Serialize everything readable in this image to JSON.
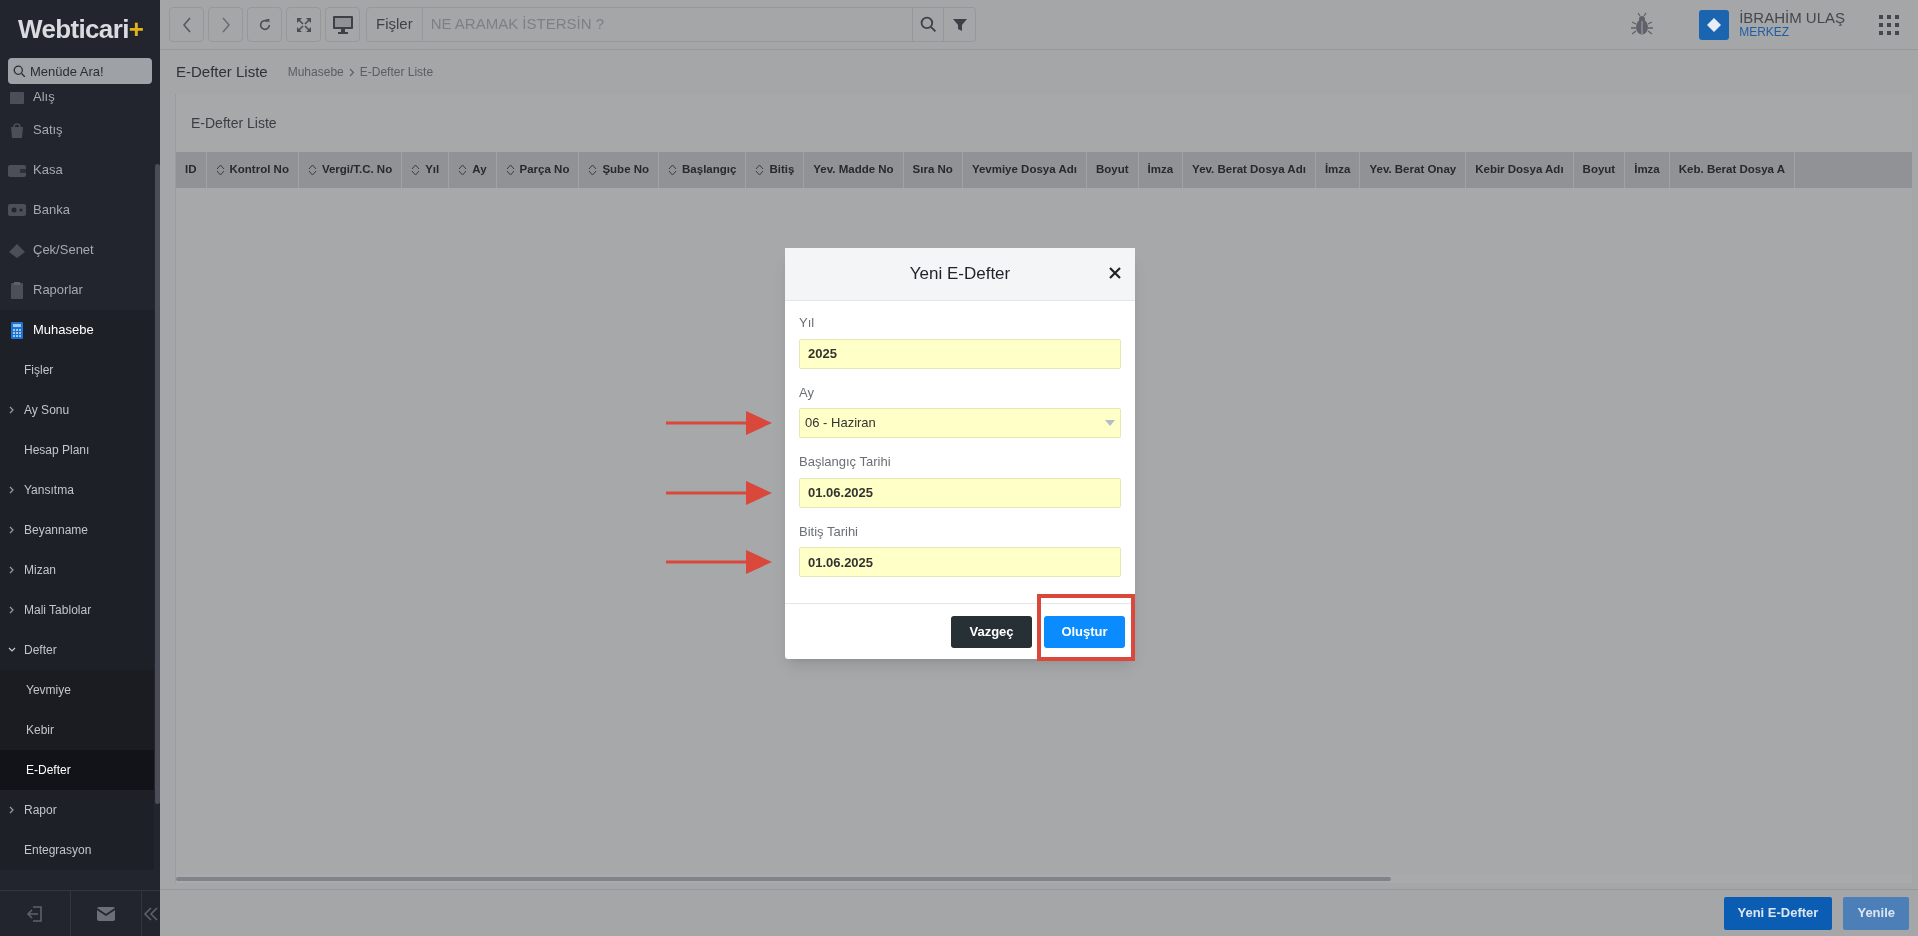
{
  "logo": {
    "text": "Webticari",
    "mark": "+"
  },
  "sidebar": {
    "search_placeholder": "Menüde Ara!",
    "items": [
      {
        "label": "Alış",
        "selected": false
      },
      {
        "label": "Satış",
        "selected": false
      },
      {
        "label": "Kasa",
        "selected": false
      },
      {
        "label": "Banka",
        "selected": false
      },
      {
        "label": "Çek/Senet",
        "selected": false
      },
      {
        "label": "Raporlar",
        "selected": false
      },
      {
        "label": "Muhasebe",
        "selected": true,
        "children": [
          {
            "label": "Fişler",
            "selected": false
          },
          {
            "label": "Ay Sonu",
            "selected": false,
            "expanded": false
          },
          {
            "label": "Hesap Planı",
            "selected": false
          },
          {
            "label": "Yansıtma",
            "selected": false,
            "expanded": false
          },
          {
            "label": "Beyanname",
            "selected": false,
            "expanded": false
          },
          {
            "label": "Mizan",
            "selected": false,
            "expanded": false
          },
          {
            "label": "Mali Tablolar",
            "selected": false,
            "expanded": false
          },
          {
            "label": "Defter",
            "selected": false,
            "expanded": true,
            "children": [
              {
                "label": "Yevmiye",
                "selected": false
              },
              {
                "label": "Kebir",
                "selected": false
              },
              {
                "label": "E-Defter",
                "selected": true
              }
            ]
          },
          {
            "label": "Rapor",
            "selected": false,
            "expanded": false
          },
          {
            "label": "Entegrasyon",
            "selected": false
          }
        ]
      }
    ]
  },
  "toolbar": {
    "module": "Fişler",
    "search_placeholder": "NE ARAMAK İSTERSİN ?"
  },
  "user": {
    "name": "İBRAHİM ULAŞ",
    "branch": "MERKEZ"
  },
  "page": {
    "title": "E-Defter Liste",
    "breadcrumb": [
      "Muhasebe",
      "E-Defter Liste"
    ],
    "card_title": "E-Defter Liste"
  },
  "table": {
    "columns": [
      {
        "label": "ID",
        "sortable": false
      },
      {
        "label": "Kontrol No",
        "sortable": true
      },
      {
        "label": "Vergi/T.C. No",
        "sortable": true
      },
      {
        "label": "Yıl",
        "sortable": true
      },
      {
        "label": "Ay",
        "sortable": true
      },
      {
        "label": "Parça No",
        "sortable": true
      },
      {
        "label": "Şube No",
        "sortable": true
      },
      {
        "label": "Başlangıç",
        "sortable": true
      },
      {
        "label": "Bitiş",
        "sortable": true
      },
      {
        "label": "Yev. Madde No",
        "sortable": false
      },
      {
        "label": "Sıra No",
        "sortable": false
      },
      {
        "label": "Yevmiye Dosya Adı",
        "sortable": false
      },
      {
        "label": "Boyut",
        "sortable": false
      },
      {
        "label": "İmza",
        "sortable": false
      },
      {
        "label": "Yev. Berat Dosya Adı",
        "sortable": false
      },
      {
        "label": "İmza",
        "sortable": false
      },
      {
        "label": "Yev. Berat Onay",
        "sortable": false
      },
      {
        "label": "Kebir Dosya Adı",
        "sortable": false
      },
      {
        "label": "Boyut",
        "sortable": false
      },
      {
        "label": "İmza",
        "sortable": false
      },
      {
        "label": "Keb. Berat Dosya A",
        "sortable": false
      }
    ]
  },
  "footer_buttons": [
    "Yeni E-Defter",
    "Yenile"
  ],
  "dialog": {
    "title": "Yeni E-Defter",
    "fields": [
      {
        "kind": "text",
        "label": "Yıl",
        "value": "2025",
        "marked": false
      },
      {
        "kind": "select",
        "label": "Ay",
        "value": "06 - Haziran",
        "marked": true
      },
      {
        "kind": "text",
        "label": "Başlangıç Tarihi",
        "value": "01.06.2025",
        "marked": true
      },
      {
        "kind": "text",
        "label": "Bitiş Tarihi",
        "value": "01.06.2025",
        "marked": true
      }
    ],
    "buttons": [
      {
        "label": "Vazgeç",
        "kind": "secondary",
        "highlighted": false
      },
      {
        "label": "Oluştur",
        "kind": "primary",
        "highlighted": true
      }
    ]
  }
}
